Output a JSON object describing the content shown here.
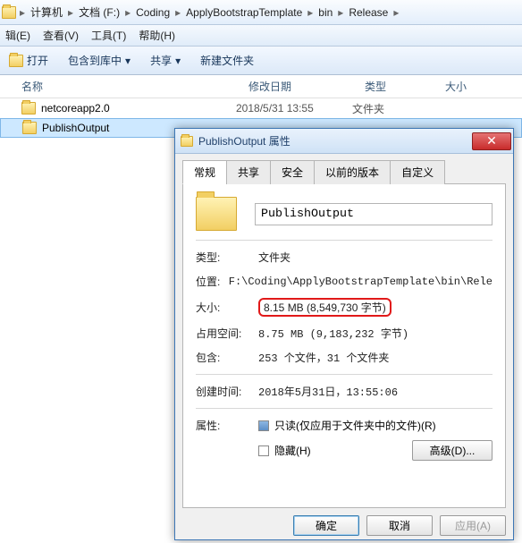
{
  "breadcrumb": {
    "c0": "计算机",
    "c1": "文档 (F:)",
    "c2": "Coding",
    "c3": "ApplyBootstrapTemplate",
    "c4": "bin",
    "c5": "Release"
  },
  "menu": {
    "edit": "辑(E)",
    "view": "查看(V)",
    "tools": "工具(T)",
    "help": "帮助(H)"
  },
  "toolbar": {
    "open": "打开",
    "include": "包含到库中",
    "share": "共享",
    "newfolder": "新建文件夹"
  },
  "cols": {
    "name": "名称",
    "mdate": "修改日期",
    "type": "类型",
    "size": "大小"
  },
  "files": {
    "r0": {
      "name": "netcoreapp2.0",
      "date": "2018/5/31 13:55",
      "type": "文件夹"
    },
    "r1": {
      "name": "PublishOutput",
      "date": "",
      "type": ""
    }
  },
  "dlg": {
    "title": "PublishOutput 属性",
    "tabs": {
      "general": "常规",
      "share": "共享",
      "security": "安全",
      "prev": "以前的版本",
      "custom": "自定义"
    },
    "name": "PublishOutput",
    "rows": {
      "type_l": "类型:",
      "type_v": "文件夹",
      "loc_l": "位置:",
      "loc_v": "F:\\Coding\\ApplyBootstrapTemplate\\bin\\Rele",
      "size_l": "大小:",
      "size_v": "8.15 MB (8,549,730 字节)",
      "disk_l": "占用空间:",
      "disk_v": "8.75 MB (9,183,232 字节)",
      "cont_l": "包含:",
      "cont_v": "253 个文件，31 个文件夹",
      "ctime_l": "创建时间:",
      "ctime_v": "2018年5月31日，13:55:06",
      "attr_l": "属性:",
      "ro": "只读(仅应用于文件夹中的文件)(R)",
      "hidden": "隐藏(H)",
      "adv": "高级(D)..."
    },
    "buttons": {
      "ok": "确定",
      "cancel": "取消",
      "apply": "应用(A)"
    }
  }
}
